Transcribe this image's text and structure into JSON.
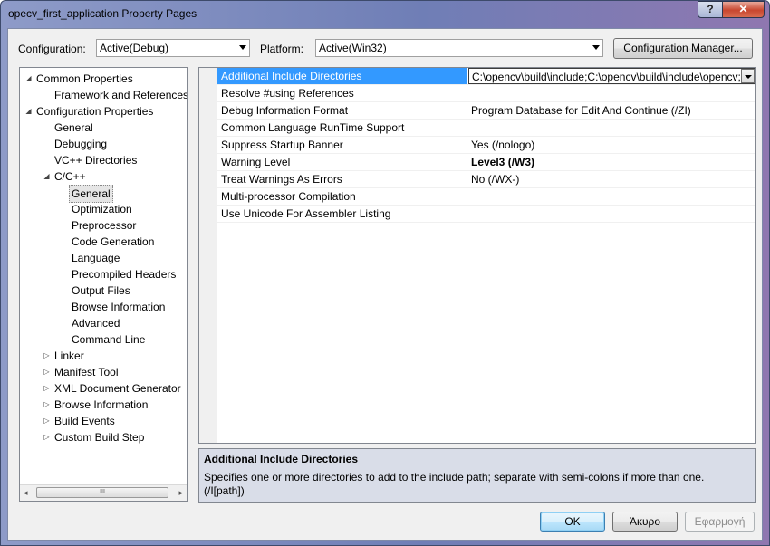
{
  "window": {
    "title": "opecv_first_application Property Pages",
    "help_label": "?",
    "close_label": "✕"
  },
  "config": {
    "label": "Configuration:",
    "value": "Active(Debug)"
  },
  "platform": {
    "label": "Platform:",
    "value": "Active(Win32)"
  },
  "config_manager_label": "Configuration Manager...",
  "tree": [
    {
      "label": "Common Properties",
      "exp": "◢"
    },
    {
      "label": "Framework and References"
    },
    {
      "label": "Configuration Properties",
      "exp": "◢"
    },
    {
      "label": "General"
    },
    {
      "label": "Debugging"
    },
    {
      "label": "VC++ Directories"
    },
    {
      "label": "C/C++",
      "exp": "◢"
    },
    {
      "label": "General"
    },
    {
      "label": "Optimization"
    },
    {
      "label": "Preprocessor"
    },
    {
      "label": "Code Generation"
    },
    {
      "label": "Language"
    },
    {
      "label": "Precompiled Headers"
    },
    {
      "label": "Output Files"
    },
    {
      "label": "Browse Information"
    },
    {
      "label": "Advanced"
    },
    {
      "label": "Command Line"
    },
    {
      "label": "Linker",
      "exp": "▷"
    },
    {
      "label": "Manifest Tool",
      "exp": "▷"
    },
    {
      "label": "XML Document Generator",
      "exp": "▷"
    },
    {
      "label": "Browse Information",
      "exp": "▷"
    },
    {
      "label": "Build Events",
      "exp": "▷"
    },
    {
      "label": "Custom Build Step",
      "exp": "▷"
    }
  ],
  "tree_scroll": {
    "left_arrow": "◂",
    "right_arrow": "▸",
    "grip": "III"
  },
  "properties": [
    {
      "name": "Additional Include Directories",
      "value": "C:\\opencv\\build\\include;C:\\opencv\\build\\include\\opencv;%(AdditionalIncludeDirectories)"
    },
    {
      "name": "Resolve #using References",
      "value": ""
    },
    {
      "name": "Debug Information Format",
      "value": "Program Database for Edit And Continue (/ZI)"
    },
    {
      "name": "Common Language RunTime Support",
      "value": ""
    },
    {
      "name": "Suppress Startup Banner",
      "value": "Yes (/nologo)"
    },
    {
      "name": "Warning Level",
      "value": "Level3 (/W3)"
    },
    {
      "name": "Treat Warnings As Errors",
      "value": "No (/WX-)"
    },
    {
      "name": "Multi-processor Compilation",
      "value": ""
    },
    {
      "name": "Use Unicode For Assembler Listing",
      "value": ""
    }
  ],
  "description": {
    "title": "Additional Include Directories",
    "text": "Specifies one or more directories to add to the include path; separate with semi-colons if more than one.",
    "switch": "(/I[path])"
  },
  "buttons": {
    "ok": "OK",
    "cancel": "Άκυρο",
    "apply": "Εφαρμογή"
  }
}
